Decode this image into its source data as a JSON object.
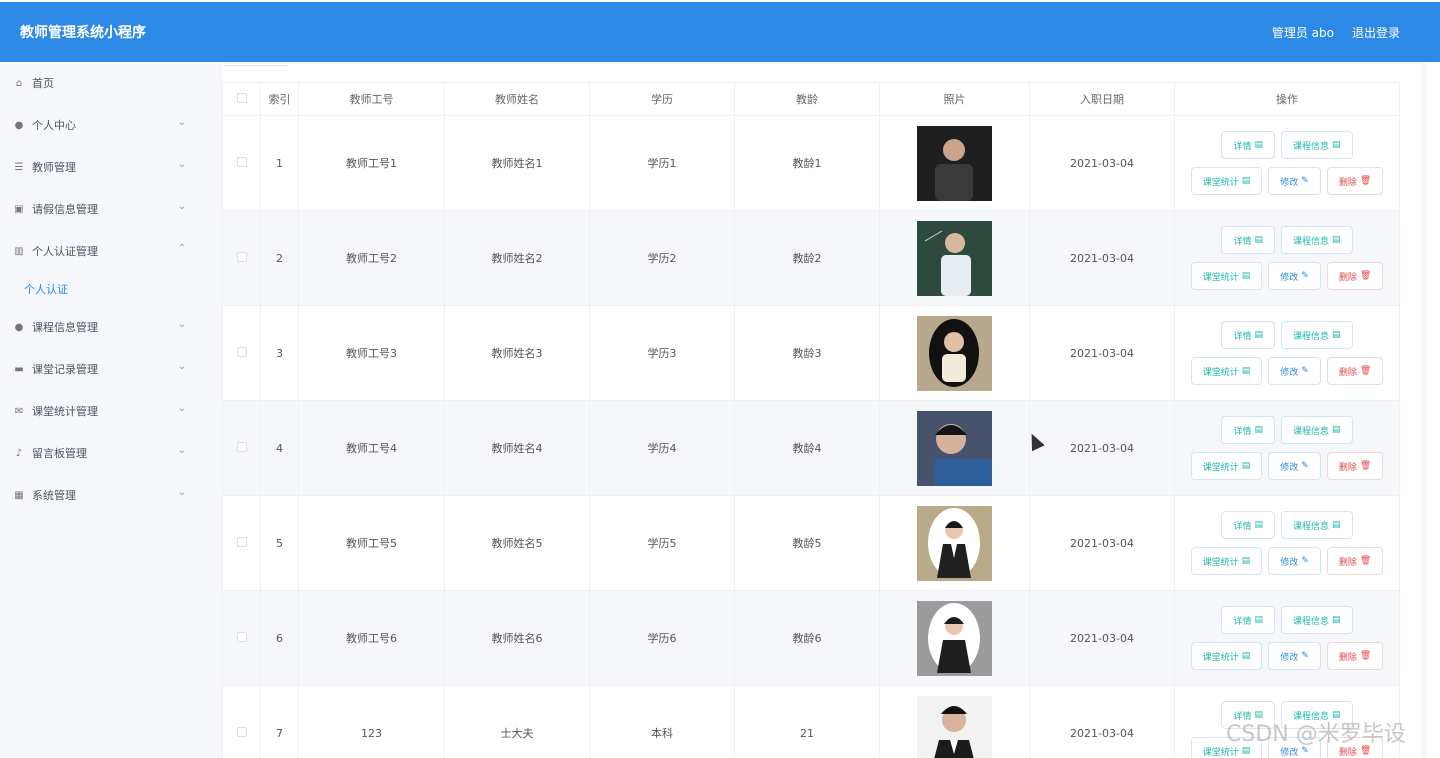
{
  "header": {
    "title": "教师管理系统小程序",
    "user": "管理员 abo",
    "logout": "退出登录"
  },
  "sidebar": {
    "items": [
      {
        "label": "首页",
        "icon": "home-icon",
        "has_arrow": false
      },
      {
        "label": "个人中心",
        "icon": "user-icon",
        "has_arrow": true
      },
      {
        "label": "教师管理",
        "icon": "list-icon",
        "has_arrow": true
      },
      {
        "label": "请假信息管理",
        "icon": "clipboard-icon",
        "has_arrow": true
      },
      {
        "label": "个人认证管理",
        "icon": "books-icon",
        "has_arrow": true,
        "expanded": true
      },
      {
        "label": "个人认证",
        "submenu": true
      },
      {
        "label": "课程信息管理",
        "icon": "user-icon",
        "has_arrow": true
      },
      {
        "label": "课堂记录管理",
        "icon": "monitor-icon",
        "has_arrow": true
      },
      {
        "label": "课堂统计管理",
        "icon": "mail-icon",
        "has_arrow": true
      },
      {
        "label": "留言板管理",
        "icon": "microphone-icon",
        "has_arrow": true
      },
      {
        "label": "系统管理",
        "icon": "grid-icon",
        "has_arrow": true
      }
    ]
  },
  "table": {
    "columns": [
      "",
      "索引",
      "教师工号",
      "教师姓名",
      "学历",
      "教龄",
      "照片",
      "入职日期",
      "操作"
    ],
    "rows": [
      {
        "index": "1",
        "id": "教师工号1",
        "name": "教师姓名1",
        "edu": "学历1",
        "age": "教龄1",
        "date": "2021-03-04"
      },
      {
        "index": "2",
        "id": "教师工号2",
        "name": "教师姓名2",
        "edu": "学历2",
        "age": "教龄2",
        "date": "2021-03-04"
      },
      {
        "index": "3",
        "id": "教师工号3",
        "name": "教师姓名3",
        "edu": "学历3",
        "age": "教龄3",
        "date": "2021-03-04"
      },
      {
        "index": "4",
        "id": "教师工号4",
        "name": "教师姓名4",
        "edu": "学历4",
        "age": "教龄4",
        "date": "2021-03-04"
      },
      {
        "index": "5",
        "id": "教师工号5",
        "name": "教师姓名5",
        "edu": "学历5",
        "age": "教龄5",
        "date": "2021-03-04"
      },
      {
        "index": "6",
        "id": "教师工号6",
        "name": "教师姓名6",
        "edu": "学历6",
        "age": "教龄6",
        "date": "2021-03-04"
      },
      {
        "index": "7",
        "id": "123",
        "name": "士大夫",
        "edu": "本科",
        "age": "21",
        "date": "2021-03-04"
      }
    ],
    "actions": {
      "detail": "详情",
      "course": "课程信息",
      "stats": "课堂统计",
      "edit": "修改",
      "delete": "删除"
    }
  },
  "watermark": "CSDN @米罗毕设",
  "colors": {
    "header": "#2c8ae6",
    "sidebar_bg": "#f5f7fb",
    "accent": "#2c8ae6",
    "delete": "#e64a4a",
    "detail": "#1fb8a8"
  }
}
